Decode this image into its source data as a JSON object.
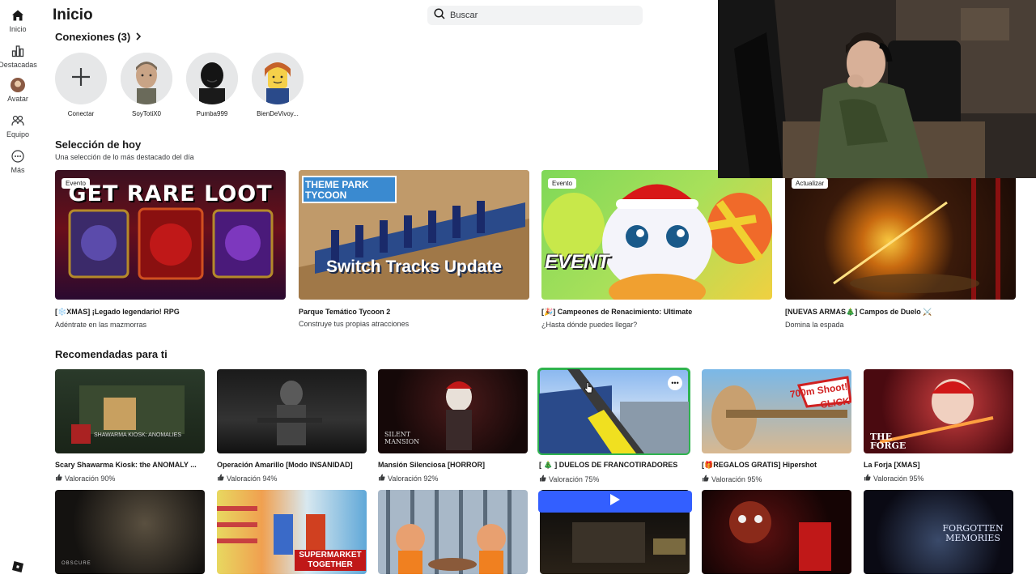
{
  "sidebar": {
    "items": [
      {
        "label": "Inicio",
        "icon": "home-icon"
      },
      {
        "label": "Destacadas",
        "icon": "chart-icon"
      },
      {
        "label": "Avatar",
        "icon": "avatar-icon"
      },
      {
        "label": "Equipo",
        "icon": "team-icon"
      },
      {
        "label": "Más",
        "icon": "more-icon"
      }
    ]
  },
  "header": {
    "title": "Inicio",
    "search_placeholder": "Buscar"
  },
  "connections": {
    "title": "Conexiones (3)",
    "items": [
      {
        "name": "Conectar"
      },
      {
        "name": "SoyTotiX0"
      },
      {
        "name": "Pumba999"
      },
      {
        "name": "BienDeVivoy..."
      }
    ]
  },
  "today": {
    "title": "Selección de hoy",
    "subtitle": "Una selección de lo más destacado del día",
    "cards": [
      {
        "badge": "Evento",
        "art": "GET RARE LOOT",
        "name": "[❄️XMAS] ¡Legado legendario! RPG",
        "sub": "Adéntrate en las mazmorras"
      },
      {
        "badge": "",
        "art": "Switch Tracks Update",
        "name": "Parque Temático Tycoon 2",
        "sub": "Construye tus propias atracciones"
      },
      {
        "badge": "Evento",
        "art": "EVENT",
        "name": "[🎉] Campeones de Renacimiento: Ultimate",
        "sub": "¿Hasta dónde puedes llegar?"
      },
      {
        "badge": "Actualizar",
        "art": "",
        "name": "[NUEVAS ARMAS🎄] Campos de Duelo ⚔️",
        "sub": "Domina la espada"
      }
    ]
  },
  "recommended": {
    "title": "Recomendadas para ti",
    "row1": [
      {
        "name": "Scary Shawarma Kiosk: the ANOMALY ...",
        "rating": "Valoración 90%",
        "art": "SHAWARMA KIOSK: ANOMALIES"
      },
      {
        "name": "Operación Amarillo [Modo INSANIDAD]",
        "rating": "Valoración 94%",
        "art": ""
      },
      {
        "name": "Mansión Silenciosa [HORROR]",
        "rating": "Valoración 92%",
        "art": "SILENT MANSION"
      },
      {
        "name": "[ 🎄 ] DUELOS DE FRANCOTIRADORES",
        "rating": "Valoración 75%",
        "art": ""
      },
      {
        "name": "[🎁REGALOS GRATIS] Hipershot",
        "rating": "Valoración 95%",
        "art": "700m Shoot! CLICK"
      },
      {
        "name": "La Forja [XMAS]",
        "rating": "Valoración 95%",
        "art": "THE FORGE"
      }
    ],
    "row2_art": [
      "OBSCURE",
      "SUPERMARKET TOGETHER",
      "",
      "",
      "",
      "FORGOTTEN MEMORIES"
    ]
  },
  "colors": {
    "accent": "#335fff",
    "highlight": "#2fb34f"
  }
}
